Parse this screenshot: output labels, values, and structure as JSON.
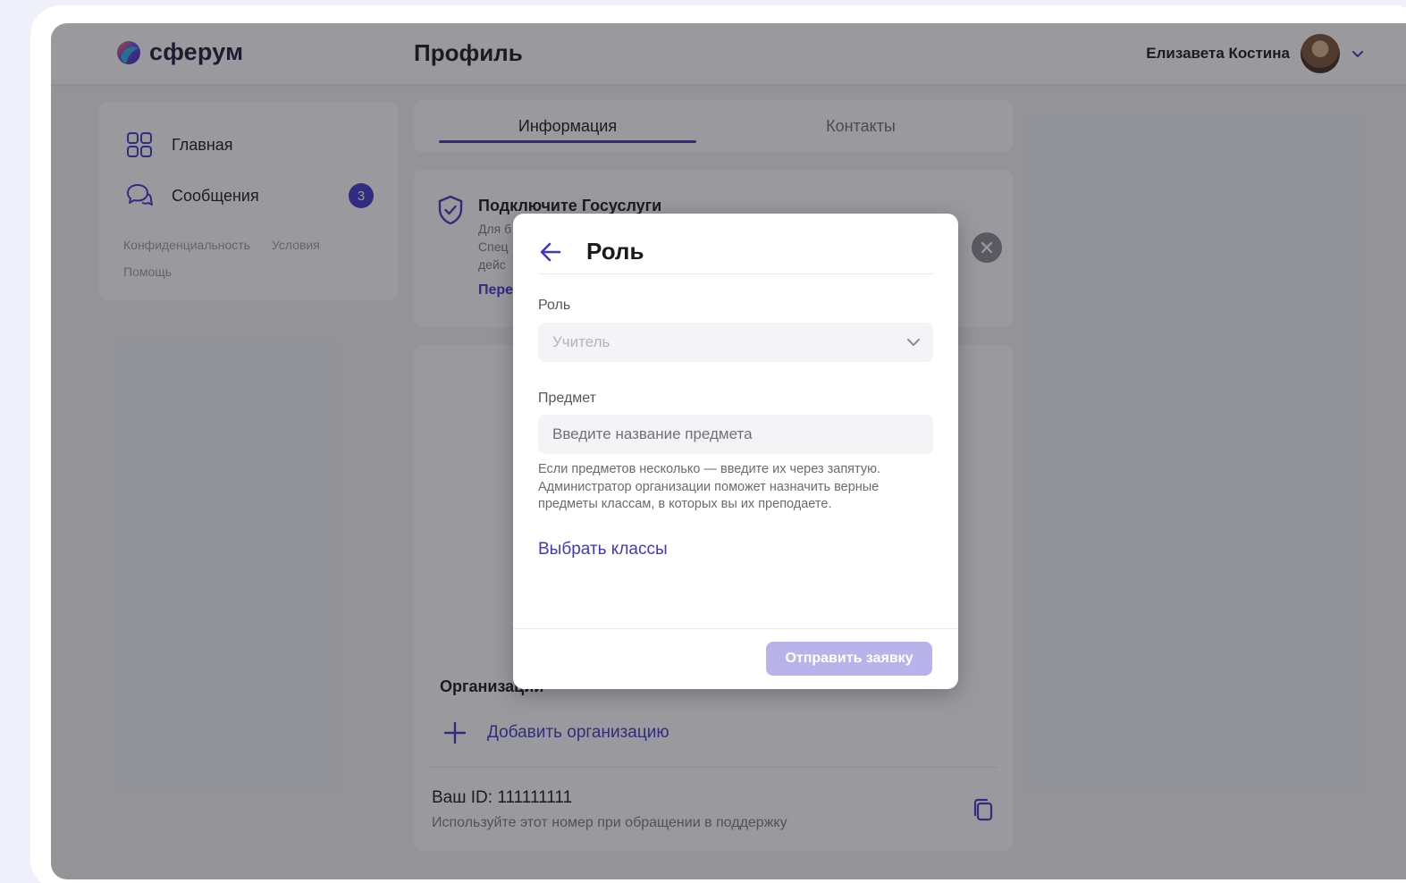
{
  "header": {
    "logo_text": "сферум",
    "page_title": "Профиль",
    "user_name": "Елизавета Костина"
  },
  "sidebar": {
    "items": [
      {
        "label": "Главная",
        "icon": "grid-icon"
      },
      {
        "label": "Сообщения",
        "icon": "chat-bubbles-icon",
        "badge": "3"
      }
    ],
    "footer_links": [
      "Конфиденциальность",
      "Условия",
      "Помощь"
    ]
  },
  "tabs": [
    {
      "label": "Информация",
      "active": true
    },
    {
      "label": "Контакты",
      "active": false
    }
  ],
  "gosuslugi": {
    "title": "Подключите Госуслуги",
    "text_fragment": "Для б\nСпец\nдейс",
    "link_fragment": "Пере"
  },
  "organizations": {
    "title": "Организации",
    "add_label": "Добавить организацию"
  },
  "account": {
    "id_text": "Ваш ID: 111111111",
    "id_hint": "Используйте этот номер при обращении в поддержку"
  },
  "modal": {
    "title": "Роль",
    "role_label": "Роль",
    "role_value": "Учитель",
    "subject_label": "Предмет",
    "subject_placeholder": "Введите название предмета",
    "hint": "Если предметов несколько — введите их через запятую. Администратор организации поможет назначить верные предметы классам, в которых вы их преподаете.",
    "choose_classes": "Выбрать классы",
    "submit": "Отправить заявку"
  },
  "colors": {
    "accent": "#3f37c9",
    "submit_disabled": "#b9b3ec",
    "overlay": "rgba(30,30,40,0.45)"
  }
}
